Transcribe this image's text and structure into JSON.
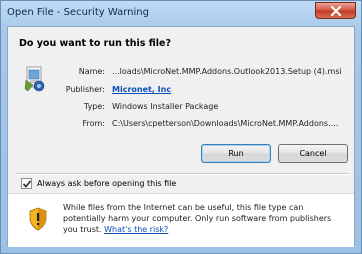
{
  "window": {
    "title": "Open File - Security Warning"
  },
  "dialog": {
    "question": "Do you want to run this file?",
    "fields": {
      "name_label": "Name:",
      "name_value": "...loads\\MicroNet.MMP.Addons.Outlook2013.Setup (4).msi",
      "publisher_label": "Publisher:",
      "publisher_value": "Micronet, Inc",
      "type_label": "Type:",
      "type_value": "Windows Installer Package",
      "from_label": "From:",
      "from_value": "C:\\Users\\cpetterson\\Downloads\\MicroNet.MMP.Addons...."
    },
    "buttons": {
      "run": "Run",
      "cancel": "Cancel"
    },
    "checkbox": {
      "label": "Always ask before opening this file",
      "checked": true
    },
    "warning": {
      "text": "While files from the Internet can be useful, this file type can potentially harm your computer. Only run software from publishers you trust.",
      "link": "What's the risk?"
    }
  },
  "icons": {
    "close": "close-icon",
    "file": "installer-file-icon",
    "checkmark": "checkmark-icon",
    "warning": "security-shield-warning-icon"
  },
  "colors": {
    "title_bar": "#a6c8ea",
    "link": "#0b4fb8",
    "close_button": "#c4361e",
    "dialog_background": "#f0f0f0"
  }
}
